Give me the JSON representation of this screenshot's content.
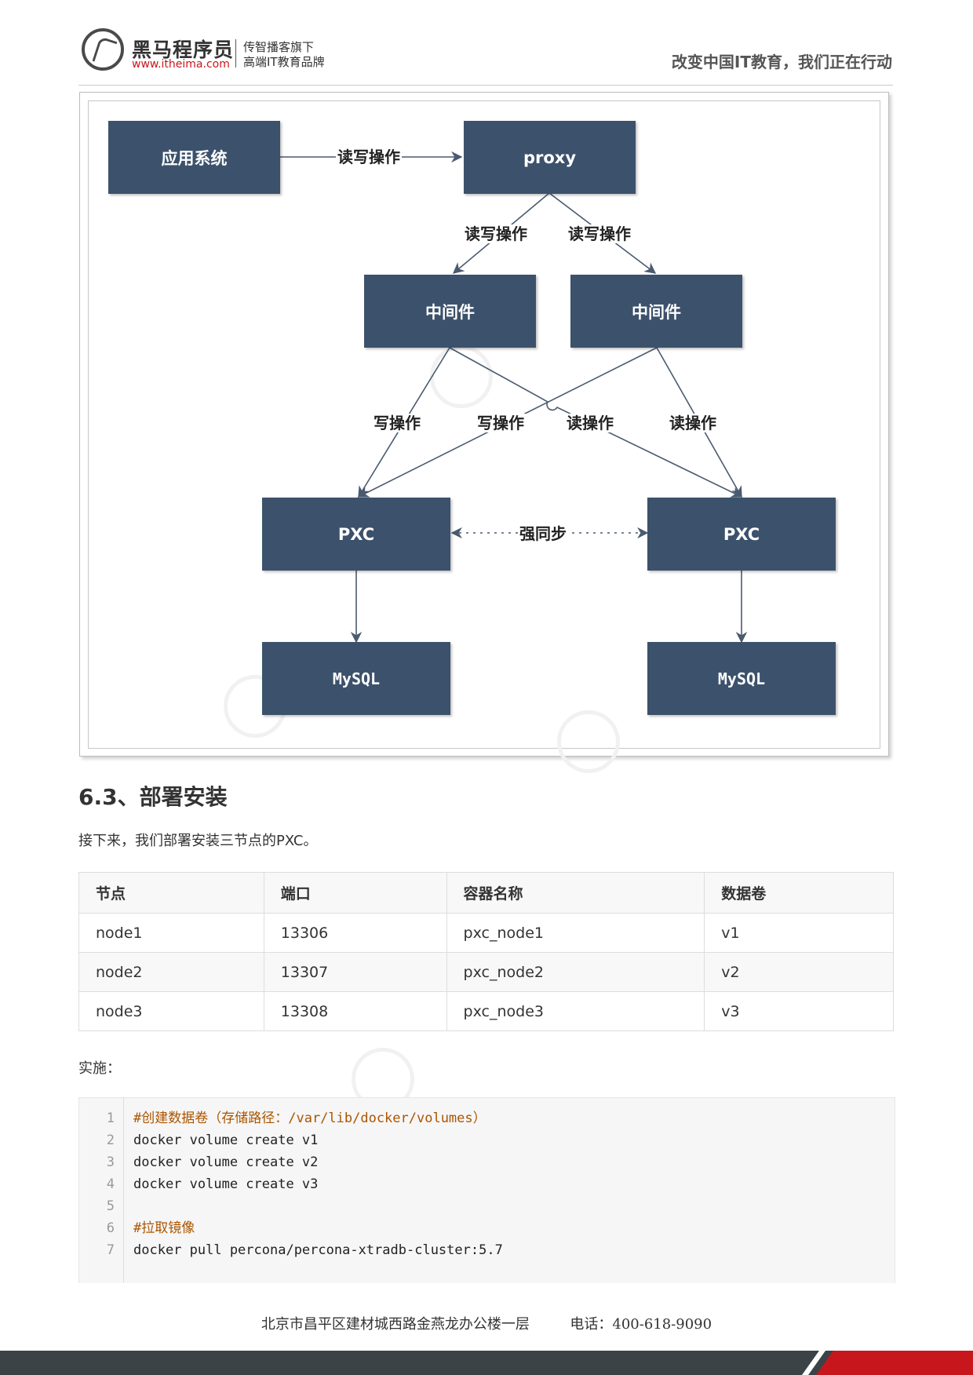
{
  "header": {
    "brand_name": "黑马程序员",
    "brand_url": "www.itheima.com",
    "tagline_line1": "传智播客旗下",
    "tagline_line2": "高端IT教育品牌",
    "slogan": "改变中国IT教育，我们正在行动"
  },
  "diagram": {
    "nodes": {
      "app": "应用系统",
      "proxy": "proxy",
      "middleware_left": "中间件",
      "middleware_right": "中间件",
      "pxc_left": "PXC",
      "pxc_right": "PXC",
      "mysql_left": "MySQL",
      "mysql_right": "MySQL"
    },
    "edge_labels": {
      "app_to_proxy": "读写操作",
      "proxy_to_mw_left": "读写操作",
      "proxy_to_mw_right": "读写操作",
      "write_left": "写操作",
      "write_cross": "写操作",
      "read_cross": "读操作",
      "read_right": "读操作",
      "sync": "强同步"
    },
    "colors": {
      "node_fill": "#3c516b",
      "edge": "#4a5a70"
    }
  },
  "section": {
    "title": "6.3、部署安装",
    "intro": "接下来，我们部署安装三节点的PXC。"
  },
  "table": {
    "headers": [
      "节点",
      "端口",
      "容器名称",
      "数据卷"
    ],
    "rows": [
      [
        "node1",
        "13306",
        "pxc_node1",
        "v1"
      ],
      [
        "node2",
        "13307",
        "pxc_node2",
        "v2"
      ],
      [
        "node3",
        "13308",
        "pxc_node3",
        "v3"
      ]
    ]
  },
  "implementation_label": "实施：",
  "code": {
    "lines": [
      {
        "num": "1",
        "text": "#创建数据卷（存储路径：/var/lib/docker/volumes）",
        "comment": true
      },
      {
        "num": "2",
        "text": "docker volume create v1",
        "comment": false
      },
      {
        "num": "3",
        "text": "docker volume create v2",
        "comment": false
      },
      {
        "num": "4",
        "text": "docker volume create v3",
        "comment": false
      },
      {
        "num": "5",
        "text": "",
        "comment": false
      },
      {
        "num": "6",
        "text": "#拉取镜像",
        "comment": true
      },
      {
        "num": "7",
        "text": "docker pull percona/percona-xtradb-cluster:5.7",
        "comment": false
      }
    ]
  },
  "footer": {
    "address": "北京市昌平区建材城西路金燕龙办公楼一层",
    "phone": "电话：400-618-9090"
  }
}
